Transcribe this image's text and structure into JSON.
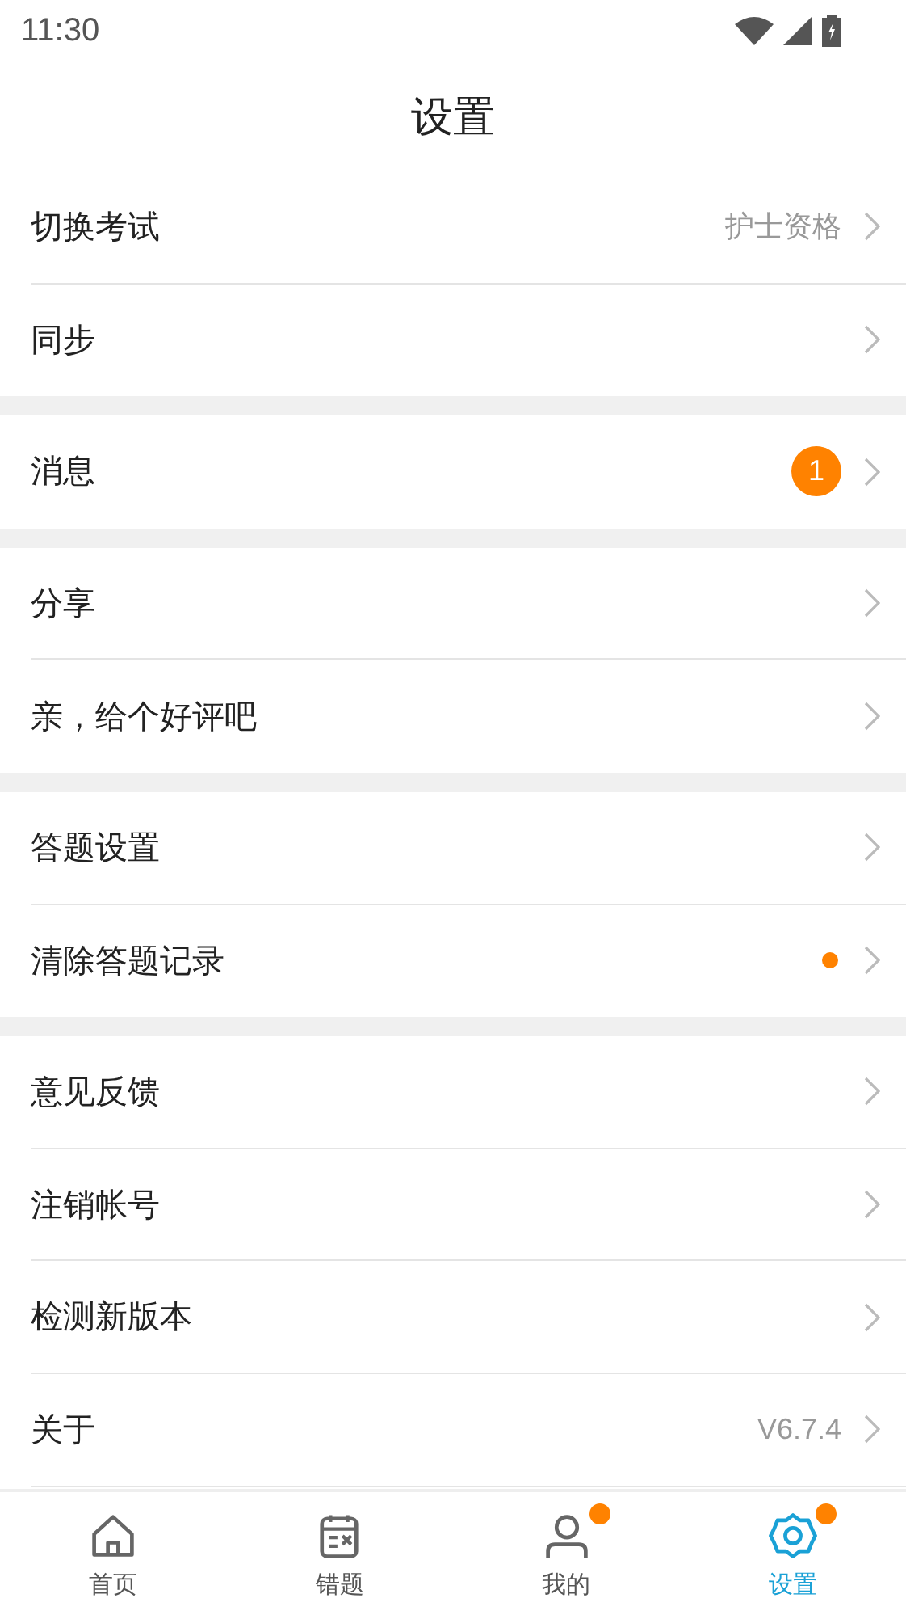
{
  "status_bar": {
    "time": "11:30"
  },
  "title": "设置",
  "groups": [
    {
      "items": [
        {
          "label": "切换考试",
          "value": "护士资格",
          "dot": false
        },
        {
          "label": "同步",
          "dot": false
        }
      ]
    },
    {
      "items": [
        {
          "label": "消息",
          "badge": "1",
          "dot": false
        }
      ]
    },
    {
      "items": [
        {
          "label": "分享",
          "dot": false
        },
        {
          "label": "亲，给个好评吧",
          "dot": false
        }
      ]
    },
    {
      "items": [
        {
          "label": "答题设置",
          "dot": false
        },
        {
          "label": "清除答题记录",
          "dot": true
        }
      ]
    },
    {
      "items": [
        {
          "label": "意见反馈",
          "dot": false
        },
        {
          "label": "注销帐号",
          "dot": false
        },
        {
          "label": "检测新版本",
          "dot": false
        },
        {
          "label": "关于",
          "value": "V6.7.4",
          "dot": false
        }
      ]
    }
  ],
  "tabs": [
    {
      "kind": "home",
      "label": "首页",
      "selected": false,
      "dot": false
    },
    {
      "kind": "wrong",
      "label": "错题",
      "selected": false,
      "dot": false
    },
    {
      "kind": "mine",
      "label": "我的",
      "selected": false,
      "dot": true
    },
    {
      "kind": "settings",
      "label": "设置",
      "selected": true,
      "dot": true
    }
  ]
}
